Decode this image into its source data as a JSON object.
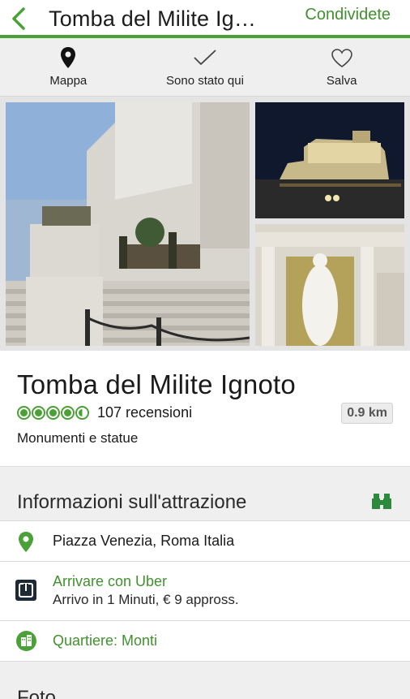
{
  "header": {
    "title": "Tomba del Milite Ig…",
    "share_label": "Condividete"
  },
  "actions": [
    {
      "label": "Mappa",
      "icon": "map-pin-icon"
    },
    {
      "label": "Sono stato qui",
      "icon": "checkmark-icon"
    },
    {
      "label": "Salva",
      "icon": "heart-icon"
    }
  ],
  "attraction": {
    "name": "Tomba del Milite Ignoto",
    "rating_bubbles": 4.5,
    "reviews": "107 recensioni",
    "distance": "0.9 km",
    "category": "Monumenti e statue"
  },
  "info_section": {
    "title": "Informazioni sull'attrazione",
    "address": "Piazza Venezia, Roma Italia",
    "uber_title": "Arrivare con Uber",
    "uber_sub": "Arrivo in 1 Minuti, € 9 appross.",
    "neighborhood": "Quartiere: Monti"
  },
  "photos_section": {
    "title": "Foto"
  },
  "colors": {
    "brand_green": "#4aa136",
    "link_green": "#41912f"
  }
}
